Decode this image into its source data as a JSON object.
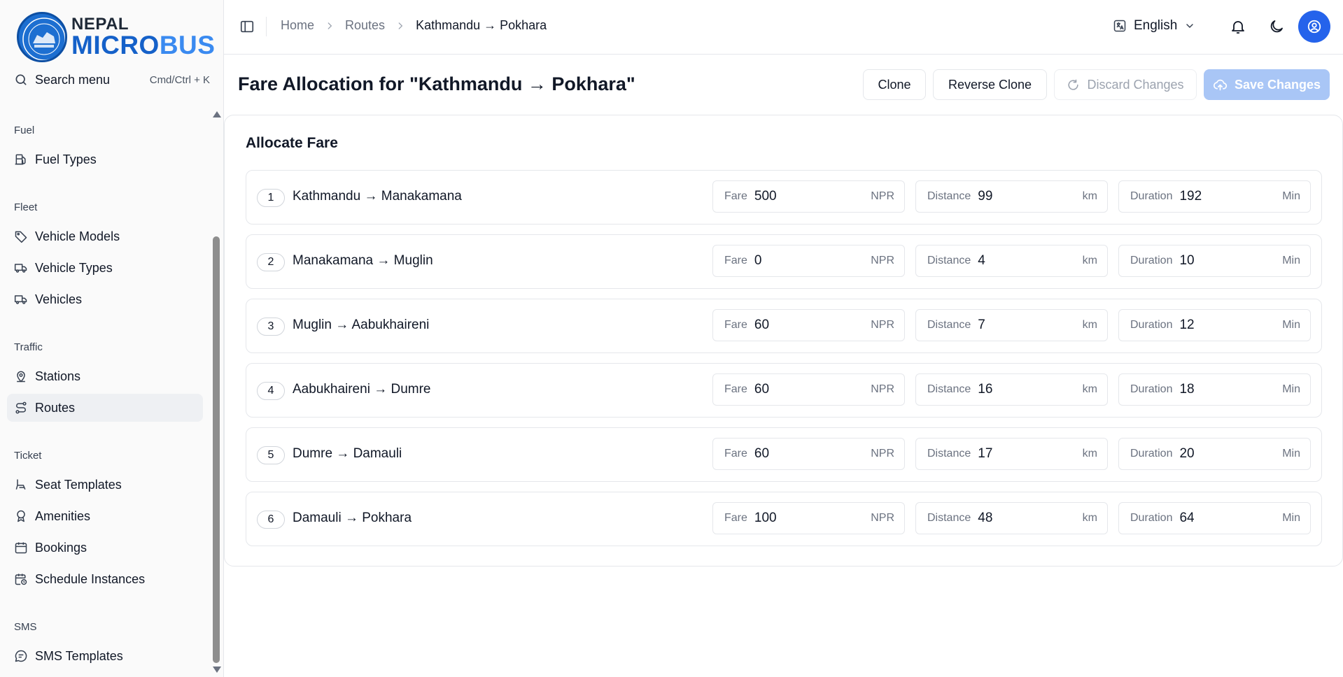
{
  "brand": {
    "line1": "NEPAL",
    "line2a": "MICRO",
    "line2b": "BUS"
  },
  "sidebar": {
    "search": {
      "label": "Search menu",
      "shortcut": "Cmd/Ctrl + K"
    },
    "groups": [
      {
        "label": "Fuel",
        "items": [
          {
            "label": "Fuel Types",
            "icon": "fuel-pump-icon"
          }
        ]
      },
      {
        "label": "Fleet",
        "items": [
          {
            "label": "Vehicle Models",
            "icon": "tag-icon"
          },
          {
            "label": "Vehicle Types",
            "icon": "truck-icon"
          },
          {
            "label": "Vehicles",
            "icon": "truck-icon"
          }
        ]
      },
      {
        "label": "Traffic",
        "items": [
          {
            "label": "Stations",
            "icon": "map-pin-icon"
          },
          {
            "label": "Routes",
            "icon": "route-icon",
            "active": true
          }
        ]
      },
      {
        "label": "Ticket",
        "items": [
          {
            "label": "Seat Templates",
            "icon": "armchair-icon"
          },
          {
            "label": "Amenities",
            "icon": "badge-icon"
          },
          {
            "label": "Bookings",
            "icon": "calendar-icon"
          },
          {
            "label": "Schedule Instances",
            "icon": "calendar-clock-icon"
          }
        ]
      },
      {
        "label": "SMS",
        "items": [
          {
            "label": "SMS Templates",
            "icon": "message-icon"
          }
        ]
      }
    ]
  },
  "topbar": {
    "breadcrumb": [
      "Home",
      "Routes",
      "Kathmandu → Pokhara"
    ],
    "language": "English"
  },
  "page": {
    "title": "Fare Allocation for \"Kathmandu → Pokhara\"",
    "buttons": {
      "clone": "Clone",
      "reverse_clone": "Reverse Clone",
      "discard": "Discard Changes",
      "save": "Save Changes"
    }
  },
  "allocate": {
    "title": "Allocate Fare",
    "labels": {
      "fare": "Fare",
      "fare_unit": "NPR",
      "distance": "Distance",
      "distance_unit": "km",
      "duration": "Duration",
      "duration_unit": "Min"
    },
    "segments": [
      {
        "num": "1",
        "name": "Kathmandu → Manakamana",
        "fare": "500",
        "distance": "99",
        "duration": "192"
      },
      {
        "num": "2",
        "name": "Manakamana → Muglin",
        "fare": "0",
        "distance": "4",
        "duration": "10"
      },
      {
        "num": "3",
        "name": "Muglin → Aabukhaireni",
        "fare": "60",
        "distance": "7",
        "duration": "12"
      },
      {
        "num": "4",
        "name": "Aabukhaireni → Dumre",
        "fare": "60",
        "distance": "16",
        "duration": "18"
      },
      {
        "num": "5",
        "name": "Dumre → Damauli",
        "fare": "60",
        "distance": "17",
        "duration": "20"
      },
      {
        "num": "6",
        "name": "Damauli → Pokhara",
        "fare": "100",
        "distance": "48",
        "duration": "64"
      }
    ]
  },
  "colors": {
    "accent": "#2563eb",
    "save_disabled": "#a9c6f6",
    "brand_dark": "#1561c9",
    "brand_light": "#3a8af0"
  }
}
